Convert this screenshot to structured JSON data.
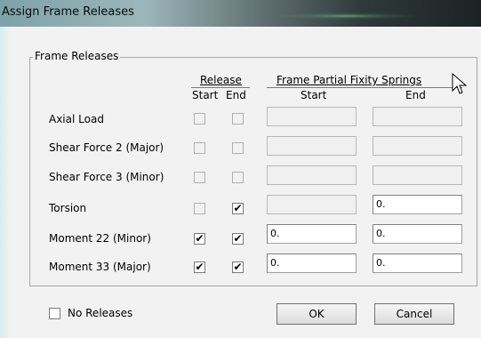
{
  "window": {
    "title": "Assign Frame Releases"
  },
  "group": {
    "label": "Frame Releases"
  },
  "headers": {
    "release": "Release",
    "springs": "Frame Partial Fixity Springs",
    "start": "Start",
    "end": "End",
    "spring_start": "Start",
    "spring_end": "End"
  },
  "rows": [
    {
      "label": "Axial Load",
      "release_start": false,
      "release_end": false,
      "spring_start": "",
      "spring_end": "",
      "spring_start_enabled": false,
      "spring_end_enabled": false
    },
    {
      "label": "Shear Force 2 (Major)",
      "release_start": false,
      "release_end": false,
      "spring_start": "",
      "spring_end": "",
      "spring_start_enabled": false,
      "spring_end_enabled": false
    },
    {
      "label": "Shear Force 3 (Minor)",
      "release_start": false,
      "release_end": false,
      "spring_start": "",
      "spring_end": "",
      "spring_start_enabled": false,
      "spring_end_enabled": false
    },
    {
      "label": "Torsion",
      "release_start": false,
      "release_end": true,
      "spring_start": "",
      "spring_end": "0.",
      "spring_start_enabled": false,
      "spring_end_enabled": true
    },
    {
      "label": "Moment 22 (Minor)",
      "release_start": true,
      "release_end": true,
      "spring_start": "0.",
      "spring_end": "0.",
      "spring_start_enabled": true,
      "spring_end_enabled": true
    },
    {
      "label": "Moment 33 (Major)",
      "release_start": true,
      "release_end": true,
      "spring_start": "0.",
      "spring_end": "0.",
      "spring_start_enabled": true,
      "spring_end_enabled": true
    }
  ],
  "no_releases": {
    "label": "No Releases",
    "checked": false
  },
  "buttons": {
    "ok": "OK",
    "cancel": "Cancel"
  },
  "icons": {
    "cursor": "pointer-cursor-icon",
    "check": "✔"
  }
}
